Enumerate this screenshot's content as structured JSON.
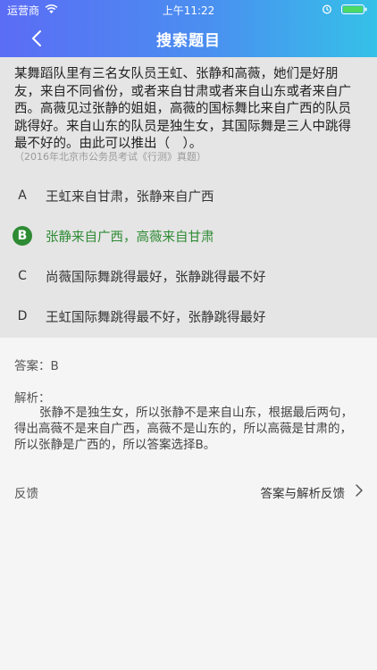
{
  "status_bar": {
    "carrier": "运营商",
    "time": "上午11:22"
  },
  "nav": {
    "title": "搜索题目",
    "back_icon": "chevron-left-icon"
  },
  "question": {
    "text": "某舞蹈队里有三名女队员王虹、张静和高薇，她们是好朋友，来自不同省份，或者来自甘肃或者来自山东或者来自广西。高薇见过张静的姐姐，高薇的国标舞比来自广西的队员跳得好。来自山东的队员是独生女，其国际舞是三人中跳得最不好的。由此可以推出（　）。",
    "source": "（2016年北京市公务员考试《行测》真题）",
    "options": [
      {
        "letter": "A",
        "text": "王虹来自甘肃，张静来自广西"
      },
      {
        "letter": "B",
        "text": "张静来自广西，高薇来自甘肃"
      },
      {
        "letter": "C",
        "text": "尚薇国际舞跳得最好，张静跳得最不好"
      },
      {
        "letter": "D",
        "text": "王虹国际舞跳得最不好，张静跳得最好"
      }
    ],
    "selected": "B"
  },
  "answer": {
    "line": "答案：B",
    "analysis_label": "解析：",
    "analysis_text": "张静不是独生女，所以张静不是来自山东，根据最后两句，得出高薇不是来自广西，高薇不是山东的，所以高薇是甘肃的，所以张静是广西的，所以答案选择B。"
  },
  "feedback": {
    "label": "反馈",
    "link": "答案与解析反馈"
  },
  "colors": {
    "header_start": "#5b6cf5",
    "header_end": "#35c1e8",
    "correct_green": "#2e8b34",
    "question_bg": "#e5e5e5",
    "page_bg": "#f5f5f5"
  }
}
